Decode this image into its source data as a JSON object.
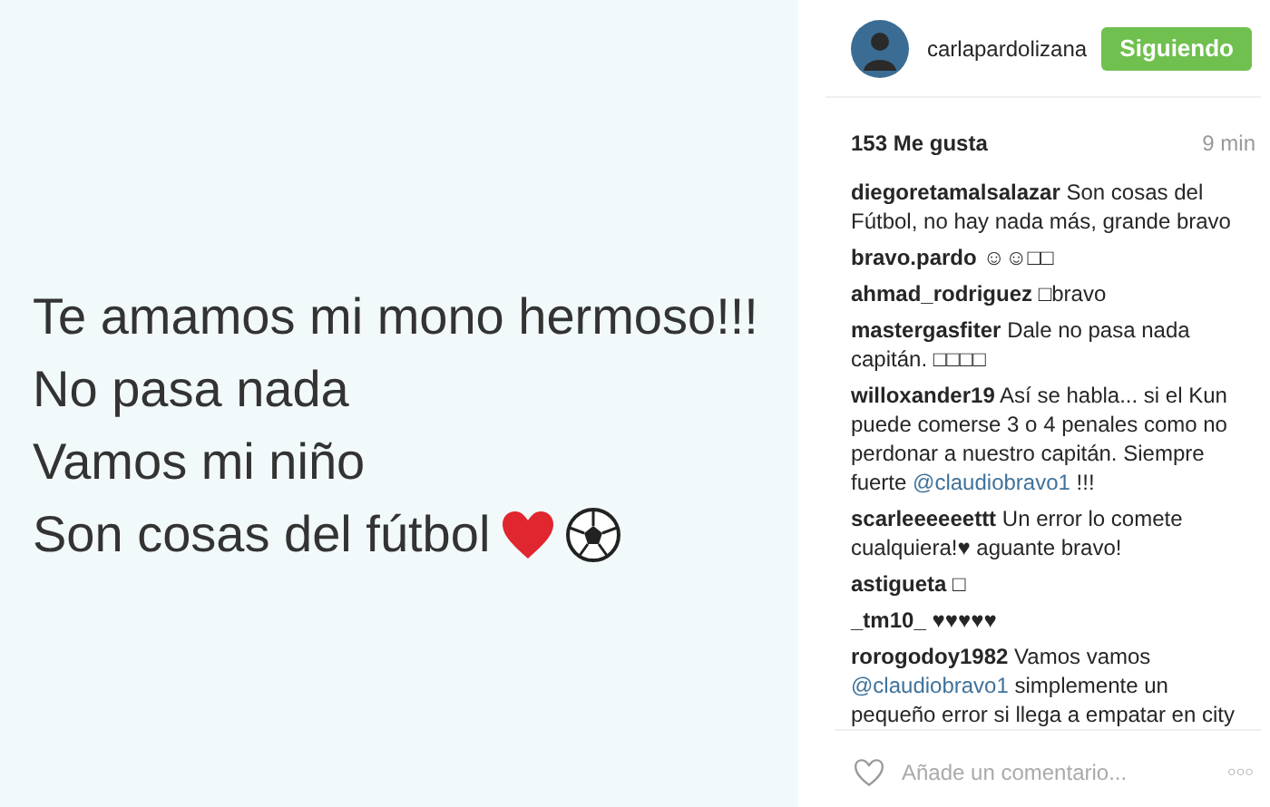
{
  "post_image": {
    "lines": [
      "Te amamos mi mono hermoso!!!",
      "No pasa nada",
      "Vamos mi niño",
      "Son cosas del fútbol"
    ]
  },
  "header": {
    "username": "carlapardolizana",
    "follow_button": "Siguiendo"
  },
  "likes": "153 Me gusta",
  "time": "9 min",
  "comments": [
    {
      "user": "diegoretamalsalazar",
      "parts": [
        {
          "kind": "text",
          "text": "Son cosas del Fútbol, no hay nada más, grande bravo"
        }
      ]
    },
    {
      "user": "bravo.pardo",
      "parts": [
        {
          "kind": "text",
          "text": "☺☺□□"
        }
      ]
    },
    {
      "user": "ahmad_rodriguez",
      "parts": [
        {
          "kind": "text",
          "text": "□bravo"
        }
      ]
    },
    {
      "user": "mastergasfiter",
      "parts": [
        {
          "kind": "text",
          "text": "Dale no pasa nada capitán. □□□□"
        }
      ]
    },
    {
      "user": "willoxander19",
      "parts": [
        {
          "kind": "text",
          "text": "Así se habla... si el Kun puede comerse 3 o 4 penales como no perdonar a nuestro capitán. Siempre fuerte "
        },
        {
          "kind": "mention",
          "text": "@claudiobravo1"
        },
        {
          "kind": "text",
          "text": " !!!"
        }
      ]
    },
    {
      "user": "scarleeeeeettt",
      "parts": [
        {
          "kind": "text",
          "text": "Un error lo comete cualquiera!♥ aguante bravo!"
        }
      ]
    },
    {
      "user": "astigueta",
      "parts": [
        {
          "kind": "text",
          "text": "□"
        }
      ]
    },
    {
      "user": "_tm10_",
      "parts": [
        {
          "kind": "text",
          "text": "♥♥♥♥♥"
        }
      ]
    },
    {
      "user": "rorogodoy1982",
      "parts": [
        {
          "kind": "text",
          "text": "Vamos vamos "
        },
        {
          "kind": "mention",
          "text": "@claudiobravo1"
        },
        {
          "kind": "text",
          "text": " simplemente un pequeño error si llega a empatar en city"
        }
      ]
    }
  ],
  "comment_input": {
    "placeholder": "Añade un comentario..."
  },
  "more_button": "○○○"
}
